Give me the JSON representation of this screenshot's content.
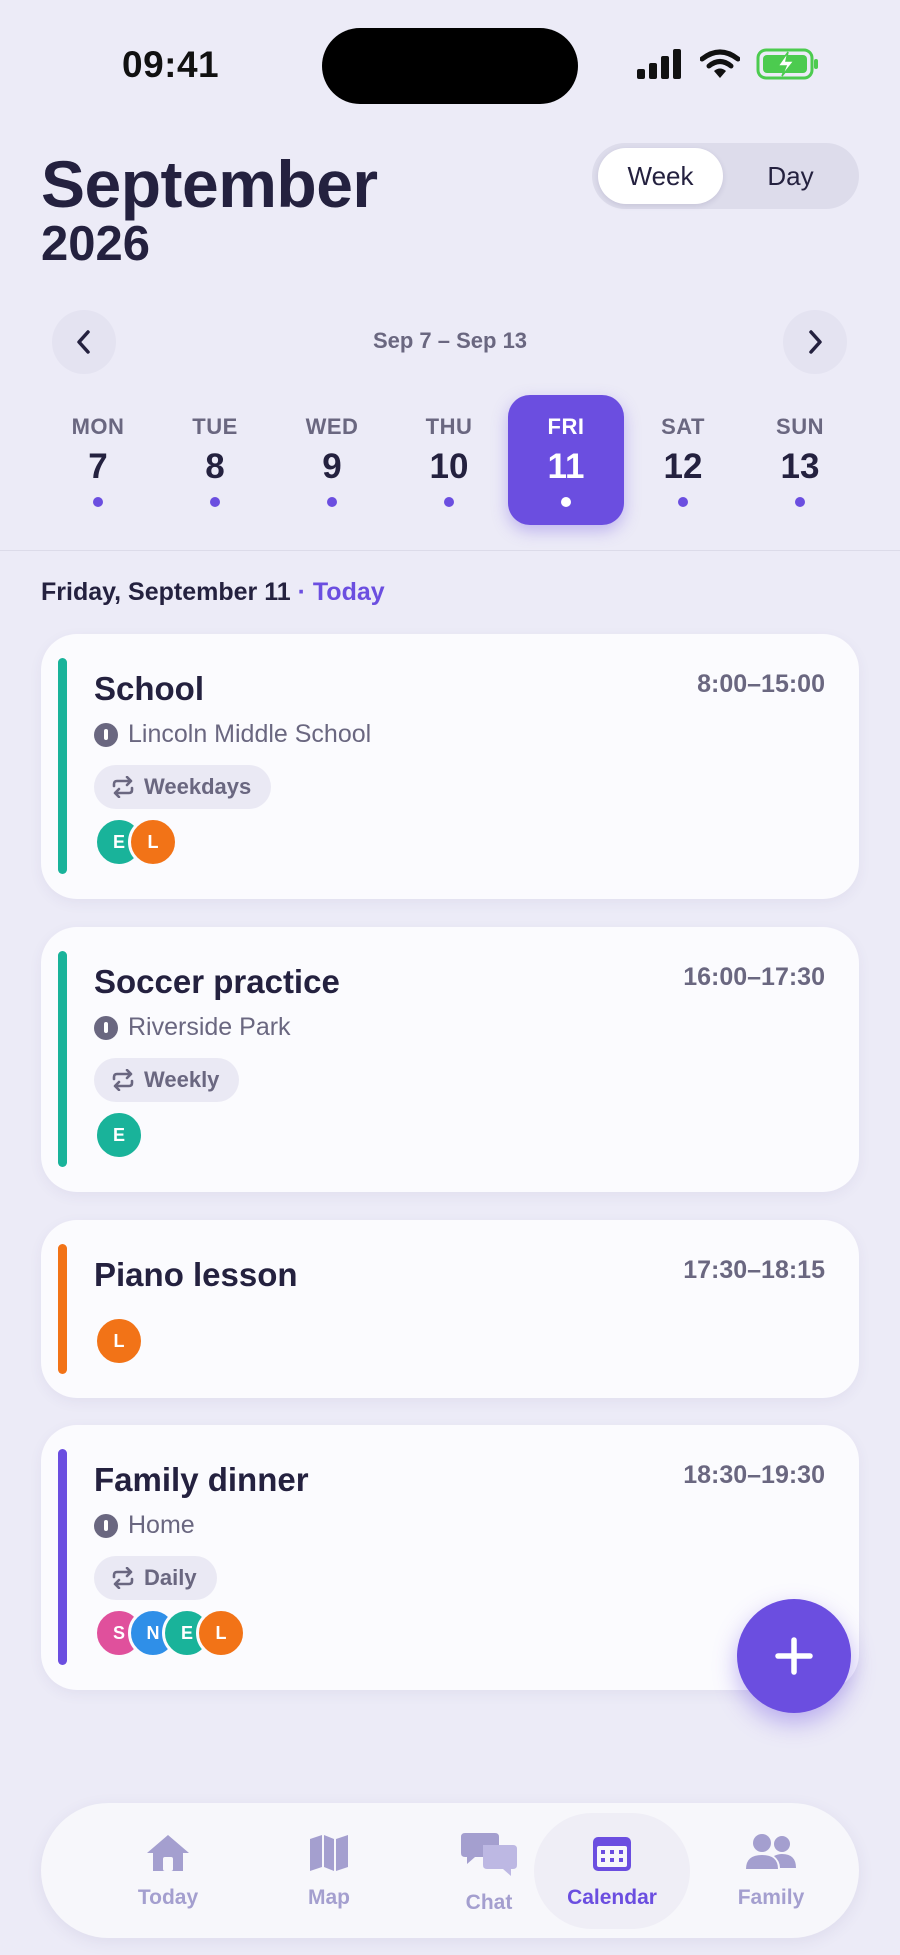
{
  "status_bar": {
    "time": "09:41"
  },
  "header": {
    "month": "September",
    "year": "2026"
  },
  "view_toggle": {
    "week": "Week",
    "day": "Day",
    "selected": "Week"
  },
  "week_nav": {
    "range": "Sep 7 – Sep 13"
  },
  "days": [
    {
      "name": "MON",
      "num": "7"
    },
    {
      "name": "TUE",
      "num": "8"
    },
    {
      "name": "WED",
      "num": "9"
    },
    {
      "name": "THU",
      "num": "10"
    },
    {
      "name": "FRI",
      "num": "11",
      "selected": true
    },
    {
      "name": "SAT",
      "num": "12"
    },
    {
      "name": "SUN",
      "num": "13"
    }
  ],
  "selected_date": {
    "label": "Friday, September 11",
    "today": "· Today"
  },
  "events": [
    {
      "title": "School",
      "time": "8:00–15:00",
      "location": "Lincoln Middle School",
      "recurrence": "Weekdays",
      "color": "#19B39A",
      "attendees": [
        {
          "initial": "E",
          "color": "#19B39A"
        },
        {
          "initial": "L",
          "color": "#F27317"
        }
      ]
    },
    {
      "title": "Soccer practice",
      "time": "16:00–17:30",
      "location": "Riverside Park",
      "recurrence": "Weekly",
      "color": "#19B39A",
      "attendees": [
        {
          "initial": "E",
          "color": "#19B39A"
        }
      ]
    },
    {
      "title": "Piano lesson",
      "time": "17:30–18:15",
      "color": "#F27317",
      "attendees": [
        {
          "initial": "L",
          "color": "#F27317"
        }
      ]
    },
    {
      "title": "Family dinner",
      "time": "18:30–19:30",
      "location": "Home",
      "recurrence": "Daily",
      "color": "#6B4EE0",
      "attendees": [
        {
          "initial": "S",
          "color": "#E0509C"
        },
        {
          "initial": "N",
          "color": "#2F8FE8"
        },
        {
          "initial": "E",
          "color": "#19B39A"
        },
        {
          "initial": "L",
          "color": "#F27317"
        }
      ]
    }
  ],
  "tabs": [
    {
      "label": "Today",
      "icon": "home-icon"
    },
    {
      "label": "Map",
      "icon": "map-icon"
    },
    {
      "label": "Chat",
      "icon": "chat-icon"
    },
    {
      "label": "Calendar",
      "icon": "calendar-icon",
      "active": true
    },
    {
      "label": "Family",
      "icon": "people-icon"
    }
  ],
  "colors": {
    "accent": "#6B4EE0",
    "background": "#ECEBF7",
    "text": "#24213F",
    "muted": "#6A6780"
  }
}
